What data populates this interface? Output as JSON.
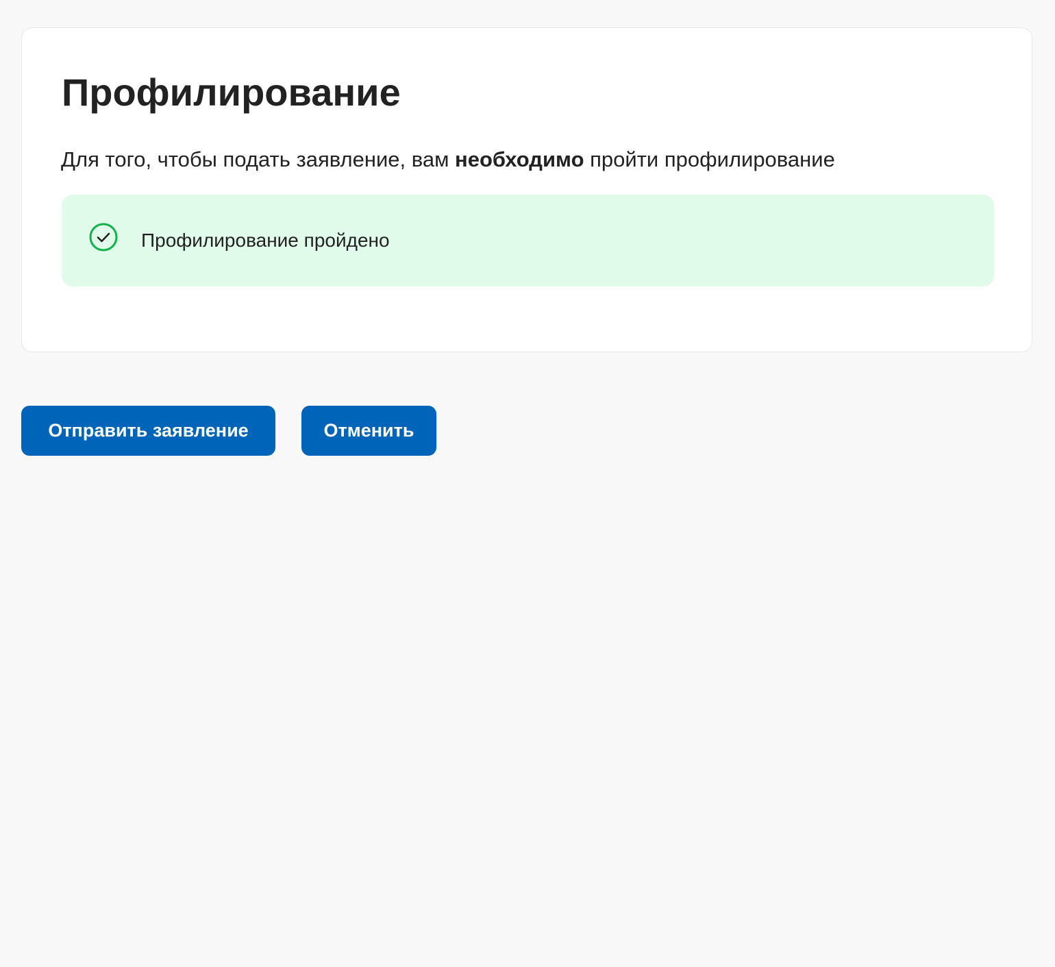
{
  "card": {
    "title": "Профилирование",
    "description": {
      "before": "Для того, чтобы подать заявление, вам ",
      "emphasis": "необходимо",
      "after": " пройти профилирование"
    },
    "status": {
      "icon": "check-circle-icon",
      "text": "Профилирование пройдено",
      "color": "#12b24a",
      "background": "#e0fbea"
    }
  },
  "actions": {
    "submit_label": "Отправить заявление",
    "cancel_label": "Отменить",
    "button_color": "#0065b8"
  }
}
